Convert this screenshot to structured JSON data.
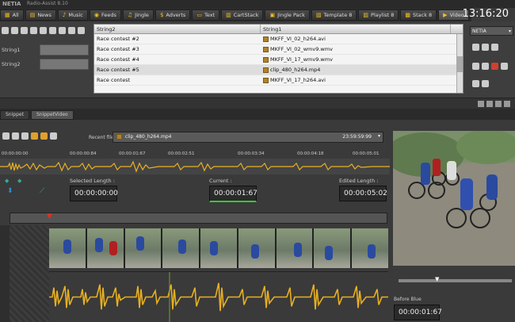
{
  "window": {
    "logo": "NETIA",
    "app_title": "Radio-Assist 8.10"
  },
  "clock": "13:16:20",
  "tabs": [
    {
      "label": "All",
      "icon": "all-icon"
    },
    {
      "label": "News",
      "icon": "news-icon"
    },
    {
      "label": "Music",
      "icon": "music-icon"
    },
    {
      "label": "Feeds",
      "icon": "feeds-icon"
    },
    {
      "label": "Jingle",
      "icon": "jingle-icon"
    },
    {
      "label": "Adverts",
      "icon": "adverts-icon"
    },
    {
      "label": "Text",
      "icon": "text-icon"
    },
    {
      "label": "CartStack",
      "icon": "cartstack-icon"
    },
    {
      "label": "Jingle Pack",
      "icon": "jingle-pack-icon"
    },
    {
      "label": "Template 8",
      "icon": "template-icon"
    },
    {
      "label": "Playlist 8",
      "icon": "playlist-icon"
    },
    {
      "label": "Stack 8",
      "icon": "stack-icon"
    },
    {
      "label": "Video",
      "icon": "video-icon",
      "active": true
    }
  ],
  "fields": {
    "string1_label": "String1",
    "string2_label": "String2"
  },
  "grid": {
    "headers": [
      "String2",
      "String1"
    ],
    "rows": [
      [
        "Race contest #2",
        "MKFF_VI_02_h264.avi"
      ],
      [
        "Race contest #3",
        "MKFF_VI_02_wmv9.wmv"
      ],
      [
        "Race contest #4",
        "MKFF_VI_17_wmv9.wmv"
      ],
      [
        "Race contest #5",
        "clip_480_h264.mp4"
      ],
      [
        "Race contest",
        "MKFF_VI_17_h264.avi"
      ]
    ],
    "selected_row": 3
  },
  "right_panel": {
    "dropdown": "NETIA"
  },
  "subtabs": [
    {
      "label": "Snippet"
    },
    {
      "label": "SnippetVideo",
      "active": true
    }
  ],
  "editor": {
    "recent_label": "Recent files:",
    "recent_file": "clip_480_h264.mp4",
    "recent_duration": "23:59:59:99",
    "ruler": [
      "00:00:00:00",
      "00:00:00:84",
      "00:00:01:67",
      "00:00:02:51",
      "00:00:03:34",
      "00:00:04:18",
      "00:00:05:01"
    ],
    "selected_length_label": "Selected Length :",
    "selected_length": "00:00:00:00",
    "current_label": "Current :",
    "current": "00:00:01:67",
    "edited_length_label": "Edited Length :",
    "edited_length": "00:00:05:02",
    "before_blue_label": "Before Blue",
    "before_blue": "00:00:01:67"
  },
  "colors": {
    "accent": "#f0c020",
    "wave": "#e8b020",
    "marker": "#e03020"
  }
}
